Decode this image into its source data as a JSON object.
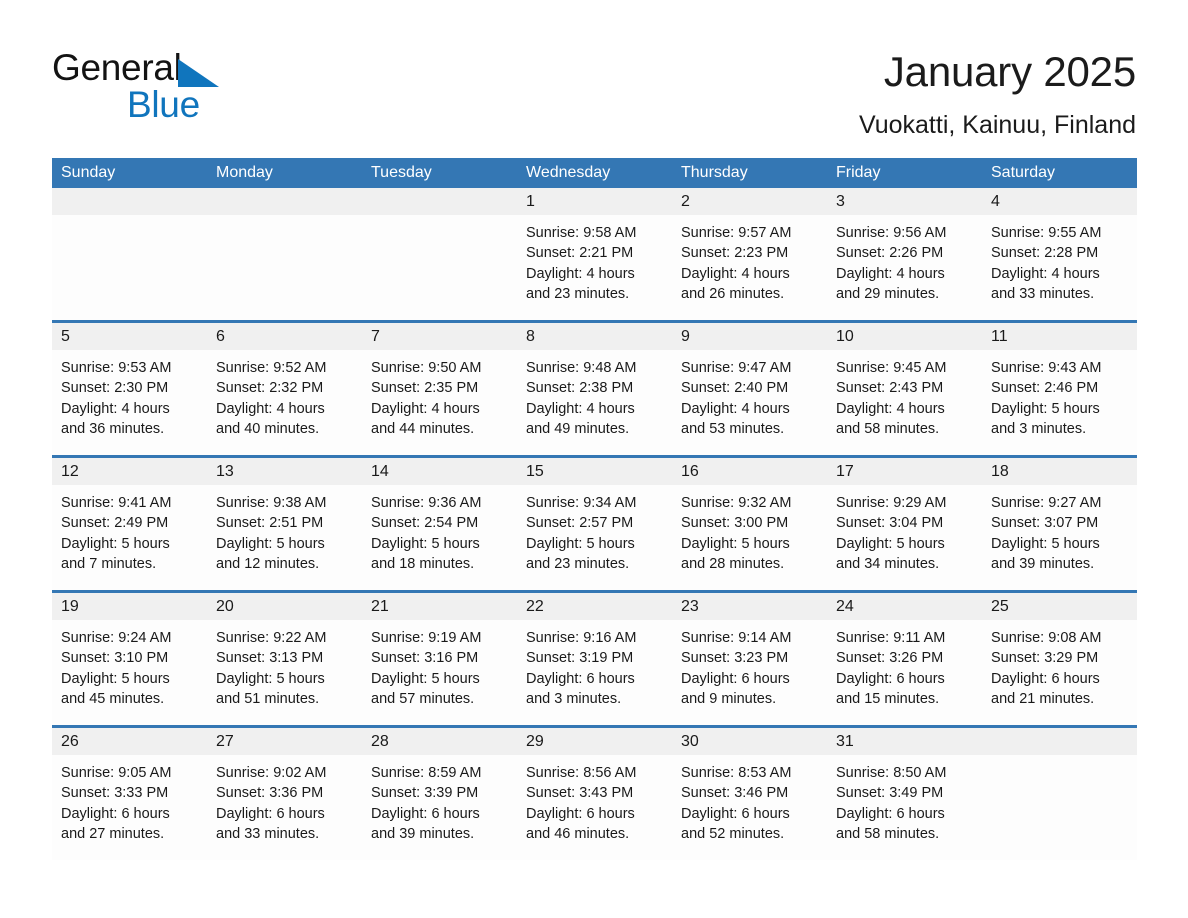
{
  "brand": {
    "name_part1": "General",
    "name_part2": "Blue",
    "triangle_icon": "brand-triangle-icon",
    "accent_color": "#1075bd"
  },
  "header": {
    "title": "January 2025",
    "subtitle": "Vuokatti, Kainuu, Finland"
  },
  "theme": {
    "header_blue": "#3477b4",
    "daynum_band": "#f0f0f0",
    "text": "#1a1a1a"
  },
  "calendar": {
    "weekdays": [
      "Sunday",
      "Monday",
      "Tuesday",
      "Wednesday",
      "Thursday",
      "Friday",
      "Saturday"
    ],
    "weeks": [
      [
        {
          "day": "",
          "empty": true
        },
        {
          "day": "",
          "empty": true
        },
        {
          "day": "",
          "empty": true
        },
        {
          "day": "1",
          "sunrise": "Sunrise: 9:58 AM",
          "sunset": "Sunset: 2:21 PM",
          "daylight_line1": "Daylight: 4 hours",
          "daylight_line2": "and 23 minutes."
        },
        {
          "day": "2",
          "sunrise": "Sunrise: 9:57 AM",
          "sunset": "Sunset: 2:23 PM",
          "daylight_line1": "Daylight: 4 hours",
          "daylight_line2": "and 26 minutes."
        },
        {
          "day": "3",
          "sunrise": "Sunrise: 9:56 AM",
          "sunset": "Sunset: 2:26 PM",
          "daylight_line1": "Daylight: 4 hours",
          "daylight_line2": "and 29 minutes."
        },
        {
          "day": "4",
          "sunrise": "Sunrise: 9:55 AM",
          "sunset": "Sunset: 2:28 PM",
          "daylight_line1": "Daylight: 4 hours",
          "daylight_line2": "and 33 minutes."
        }
      ],
      [
        {
          "day": "5",
          "sunrise": "Sunrise: 9:53 AM",
          "sunset": "Sunset: 2:30 PM",
          "daylight_line1": "Daylight: 4 hours",
          "daylight_line2": "and 36 minutes."
        },
        {
          "day": "6",
          "sunrise": "Sunrise: 9:52 AM",
          "sunset": "Sunset: 2:32 PM",
          "daylight_line1": "Daylight: 4 hours",
          "daylight_line2": "and 40 minutes."
        },
        {
          "day": "7",
          "sunrise": "Sunrise: 9:50 AM",
          "sunset": "Sunset: 2:35 PM",
          "daylight_line1": "Daylight: 4 hours",
          "daylight_line2": "and 44 minutes."
        },
        {
          "day": "8",
          "sunrise": "Sunrise: 9:48 AM",
          "sunset": "Sunset: 2:38 PM",
          "daylight_line1": "Daylight: 4 hours",
          "daylight_line2": "and 49 minutes."
        },
        {
          "day": "9",
          "sunrise": "Sunrise: 9:47 AM",
          "sunset": "Sunset: 2:40 PM",
          "daylight_line1": "Daylight: 4 hours",
          "daylight_line2": "and 53 minutes."
        },
        {
          "day": "10",
          "sunrise": "Sunrise: 9:45 AM",
          "sunset": "Sunset: 2:43 PM",
          "daylight_line1": "Daylight: 4 hours",
          "daylight_line2": "and 58 minutes."
        },
        {
          "day": "11",
          "sunrise": "Sunrise: 9:43 AM",
          "sunset": "Sunset: 2:46 PM",
          "daylight_line1": "Daylight: 5 hours",
          "daylight_line2": "and 3 minutes."
        }
      ],
      [
        {
          "day": "12",
          "sunrise": "Sunrise: 9:41 AM",
          "sunset": "Sunset: 2:49 PM",
          "daylight_line1": "Daylight: 5 hours",
          "daylight_line2": "and 7 minutes."
        },
        {
          "day": "13",
          "sunrise": "Sunrise: 9:38 AM",
          "sunset": "Sunset: 2:51 PM",
          "daylight_line1": "Daylight: 5 hours",
          "daylight_line2": "and 12 minutes."
        },
        {
          "day": "14",
          "sunrise": "Sunrise: 9:36 AM",
          "sunset": "Sunset: 2:54 PM",
          "daylight_line1": "Daylight: 5 hours",
          "daylight_line2": "and 18 minutes."
        },
        {
          "day": "15",
          "sunrise": "Sunrise: 9:34 AM",
          "sunset": "Sunset: 2:57 PM",
          "daylight_line1": "Daylight: 5 hours",
          "daylight_line2": "and 23 minutes."
        },
        {
          "day": "16",
          "sunrise": "Sunrise: 9:32 AM",
          "sunset": "Sunset: 3:00 PM",
          "daylight_line1": "Daylight: 5 hours",
          "daylight_line2": "and 28 minutes."
        },
        {
          "day": "17",
          "sunrise": "Sunrise: 9:29 AM",
          "sunset": "Sunset: 3:04 PM",
          "daylight_line1": "Daylight: 5 hours",
          "daylight_line2": "and 34 minutes."
        },
        {
          "day": "18",
          "sunrise": "Sunrise: 9:27 AM",
          "sunset": "Sunset: 3:07 PM",
          "daylight_line1": "Daylight: 5 hours",
          "daylight_line2": "and 39 minutes."
        }
      ],
      [
        {
          "day": "19",
          "sunrise": "Sunrise: 9:24 AM",
          "sunset": "Sunset: 3:10 PM",
          "daylight_line1": "Daylight: 5 hours",
          "daylight_line2": "and 45 minutes."
        },
        {
          "day": "20",
          "sunrise": "Sunrise: 9:22 AM",
          "sunset": "Sunset: 3:13 PM",
          "daylight_line1": "Daylight: 5 hours",
          "daylight_line2": "and 51 minutes."
        },
        {
          "day": "21",
          "sunrise": "Sunrise: 9:19 AM",
          "sunset": "Sunset: 3:16 PM",
          "daylight_line1": "Daylight: 5 hours",
          "daylight_line2": "and 57 minutes."
        },
        {
          "day": "22",
          "sunrise": "Sunrise: 9:16 AM",
          "sunset": "Sunset: 3:19 PM",
          "daylight_line1": "Daylight: 6 hours",
          "daylight_line2": "and 3 minutes."
        },
        {
          "day": "23",
          "sunrise": "Sunrise: 9:14 AM",
          "sunset": "Sunset: 3:23 PM",
          "daylight_line1": "Daylight: 6 hours",
          "daylight_line2": "and 9 minutes."
        },
        {
          "day": "24",
          "sunrise": "Sunrise: 9:11 AM",
          "sunset": "Sunset: 3:26 PM",
          "daylight_line1": "Daylight: 6 hours",
          "daylight_line2": "and 15 minutes."
        },
        {
          "day": "25",
          "sunrise": "Sunrise: 9:08 AM",
          "sunset": "Sunset: 3:29 PM",
          "daylight_line1": "Daylight: 6 hours",
          "daylight_line2": "and 21 minutes."
        }
      ],
      [
        {
          "day": "26",
          "sunrise": "Sunrise: 9:05 AM",
          "sunset": "Sunset: 3:33 PM",
          "daylight_line1": "Daylight: 6 hours",
          "daylight_line2": "and 27 minutes."
        },
        {
          "day": "27",
          "sunrise": "Sunrise: 9:02 AM",
          "sunset": "Sunset: 3:36 PM",
          "daylight_line1": "Daylight: 6 hours",
          "daylight_line2": "and 33 minutes."
        },
        {
          "day": "28",
          "sunrise": "Sunrise: 8:59 AM",
          "sunset": "Sunset: 3:39 PM",
          "daylight_line1": "Daylight: 6 hours",
          "daylight_line2": "and 39 minutes."
        },
        {
          "day": "29",
          "sunrise": "Sunrise: 8:56 AM",
          "sunset": "Sunset: 3:43 PM",
          "daylight_line1": "Daylight: 6 hours",
          "daylight_line2": "and 46 minutes."
        },
        {
          "day": "30",
          "sunrise": "Sunrise: 8:53 AM",
          "sunset": "Sunset: 3:46 PM",
          "daylight_line1": "Daylight: 6 hours",
          "daylight_line2": "and 52 minutes."
        },
        {
          "day": "31",
          "sunrise": "Sunrise: 8:50 AM",
          "sunset": "Sunset: 3:49 PM",
          "daylight_line1": "Daylight: 6 hours",
          "daylight_line2": "and 58 minutes."
        },
        {
          "day": "",
          "empty": true
        }
      ]
    ]
  }
}
